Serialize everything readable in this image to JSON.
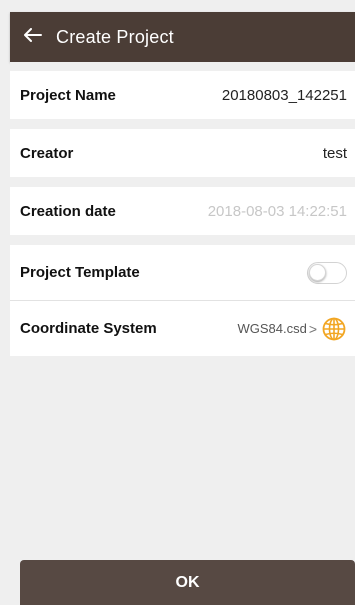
{
  "header": {
    "title": "Create Project",
    "back_icon": "arrow-left-icon"
  },
  "form": {
    "project_name": {
      "label": "Project Name",
      "value": "20180803_142251"
    },
    "creator": {
      "label": "Creator",
      "value": "test"
    },
    "creation_date": {
      "label": "Creation date",
      "value": "2018-08-03 14:22:51"
    },
    "project_template": {
      "label": "Project Template",
      "enabled": false
    },
    "coordinate_system": {
      "label": "Coordinate System",
      "value": "WGS84.csd",
      "chevron": ">",
      "icon": "globe-icon"
    }
  },
  "footer": {
    "ok_label": "OK"
  },
  "colors": {
    "appbar": "#4b3d36",
    "button": "#574943",
    "globe": "#f2a623",
    "background": "#efefef"
  }
}
